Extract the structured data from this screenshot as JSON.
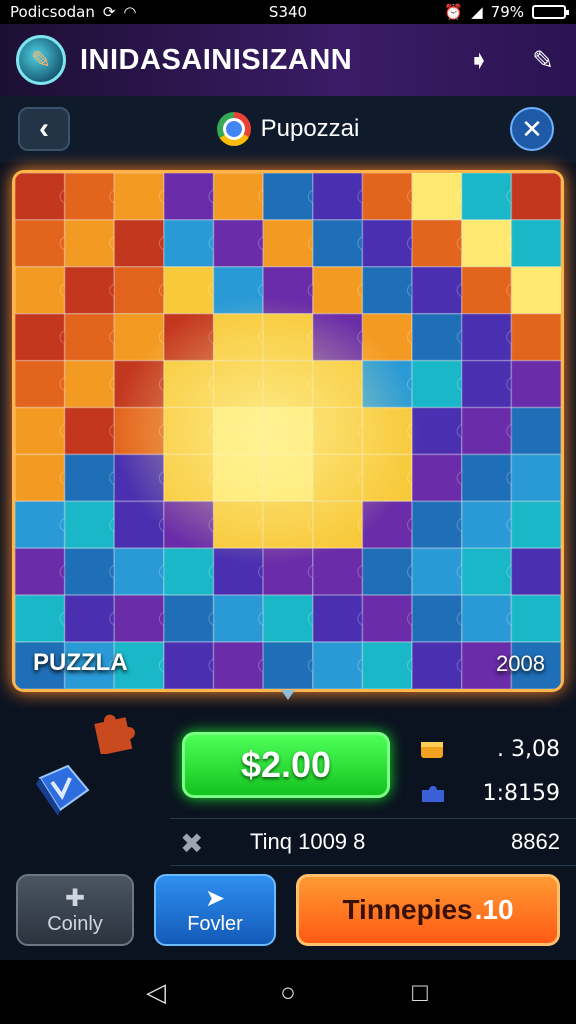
{
  "status_bar": {
    "left_text": "Podicsodan",
    "time": "S340",
    "battery": "79%"
  },
  "app_bar": {
    "title": "INIDASAINISIZANN"
  },
  "header": {
    "title": "Pupozzai"
  },
  "board": {
    "label": "PUZZLA",
    "number": "2008",
    "palette": [
      "#c4371f",
      "#e3641c",
      "#f39a22",
      "#f8c93a",
      "#ffe870",
      "#1f6fb8",
      "#2a9ad6",
      "#19b7c7",
      "#4a2fb0",
      "#6a2ca8"
    ]
  },
  "price_button": {
    "label": "$2.00"
  },
  "stats": {
    "top_value": ". 3,08",
    "bottom_value": "1:8159"
  },
  "info_row": {
    "label": "Tinq 1009 8",
    "value": "8862"
  },
  "buttons": {
    "left": "Coinly",
    "middle": "Fovler",
    "right_text": "Tinnepies",
    "right_number": ".10"
  },
  "icons": {
    "app_logo": "puzzle-globe-icon",
    "app_action_1": "send-icon",
    "app_action_2": "edit-icon",
    "back": "chevron-left-icon",
    "close": "close-icon"
  }
}
